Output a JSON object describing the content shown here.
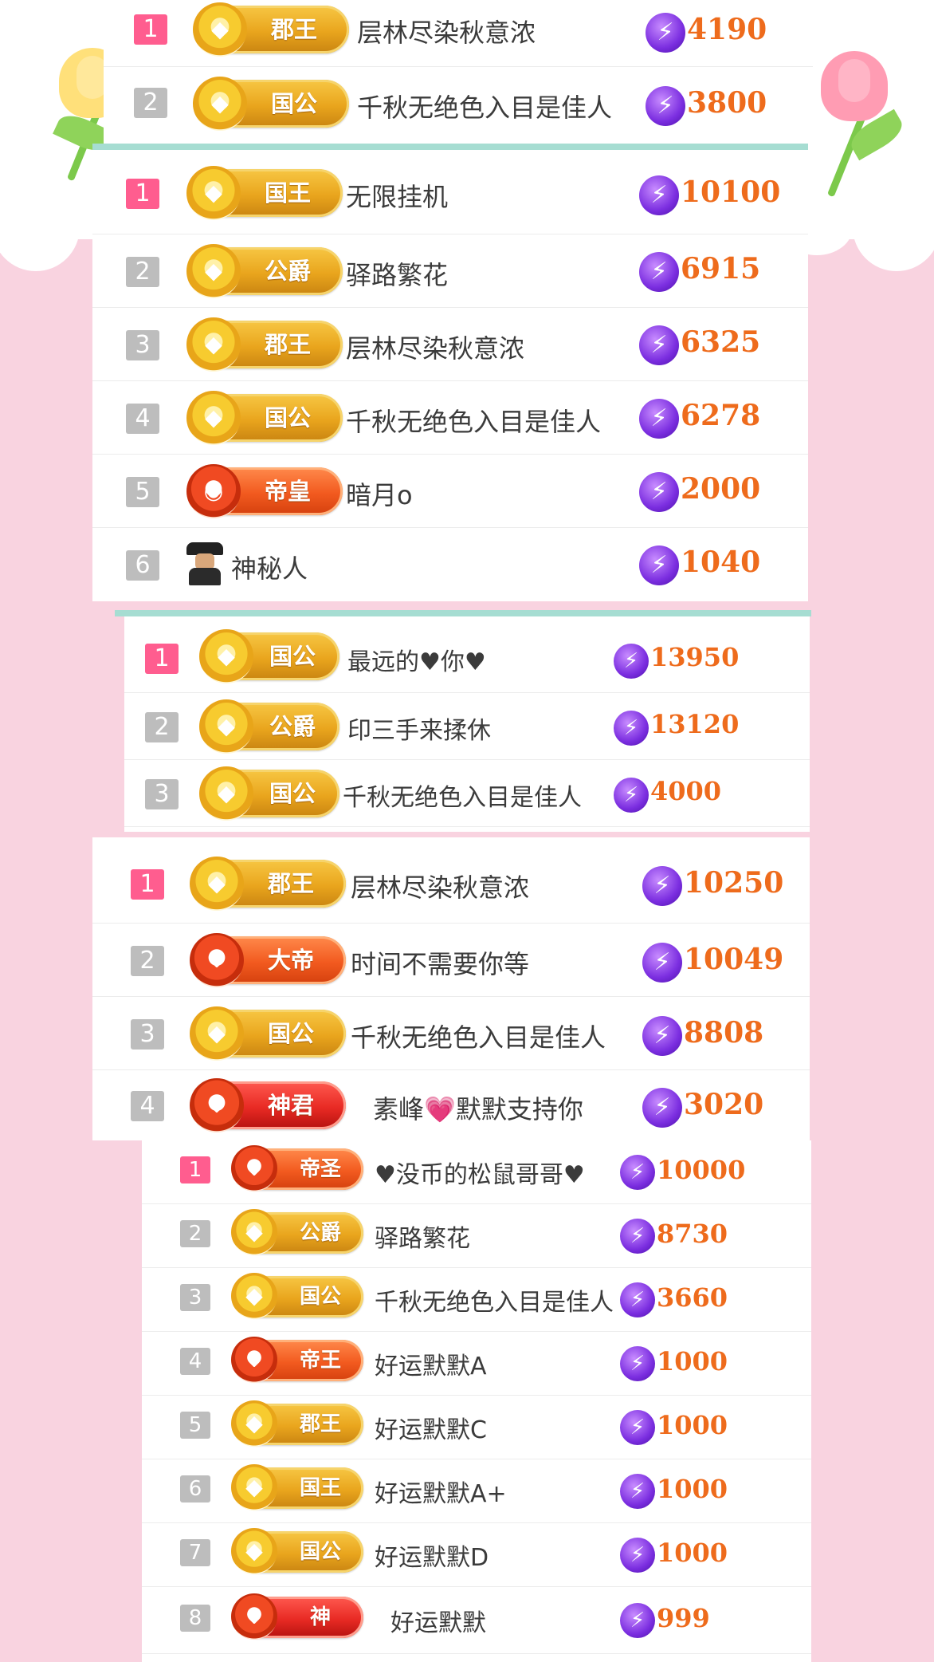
{
  "colors": {
    "page_bg": "#f9d3e0",
    "divider": "#a6ddd2",
    "score": "#ee6b1c",
    "rank_first": "#ff5d8f",
    "rank_other": "#bdbdbd",
    "badge_gold": "#e9a51d",
    "badge_red": "#f25a1f"
  },
  "icons": {
    "coin": "coin-icon",
    "bolt": "lightning-icon",
    "spy": "mystery-person-icon",
    "tulip": "tulip-icon"
  },
  "boards": [
    {
      "rows": [
        {
          "rank": "1",
          "badge": "郡王",
          "badge_style": "gold",
          "name": "层林尽染秋意浓",
          "score": "4190"
        },
        {
          "rank": "2",
          "badge": "国公",
          "badge_style": "gold",
          "name": "千秋无绝色入目是佳人",
          "score": "3800"
        }
      ]
    },
    {
      "rows": [
        {
          "rank": "1",
          "badge": "国王",
          "badge_style": "gold",
          "name": "无限挂机",
          "score": "10100"
        },
        {
          "rank": "2",
          "badge": "公爵",
          "badge_style": "gold",
          "name": "驿路繁花",
          "score": "6915"
        },
        {
          "rank": "3",
          "badge": "郡王",
          "badge_style": "gold",
          "name": "层林尽染秋意浓",
          "score": "6325"
        },
        {
          "rank": "4",
          "badge": "国公",
          "badge_style": "gold",
          "name": "千秋无绝色入目是佳人",
          "score": "6278"
        },
        {
          "rank": "5",
          "badge": "帝皇",
          "badge_style": "red",
          "name": "暗月o",
          "score": "2000"
        },
        {
          "rank": "6",
          "badge": "",
          "badge_style": "none",
          "name": "神秘人",
          "score": "1040"
        }
      ]
    },
    {
      "rows": [
        {
          "rank": "1",
          "badge": "国公",
          "badge_style": "gold",
          "name": "最远的♥你♥",
          "score": "13950"
        },
        {
          "rank": "2",
          "badge": "公爵",
          "badge_style": "gold",
          "name": "印三手来揉休",
          "score": "13120"
        },
        {
          "rank": "3",
          "badge": "国公",
          "badge_style": "gold",
          "name": "千秋无绝色入目是佳人",
          "score": "4000"
        }
      ]
    },
    {
      "rows": [
        {
          "rank": "1",
          "badge": "郡王",
          "badge_style": "gold",
          "name": "层林尽染秋意浓",
          "score": "10250"
        },
        {
          "rank": "2",
          "badge": "大帝",
          "badge_style": "red",
          "name": "时间不需要你等",
          "score": "10049"
        },
        {
          "rank": "3",
          "badge": "国公",
          "badge_style": "gold",
          "name": "千秋无绝色入目是佳人",
          "score": "8808"
        },
        {
          "rank": "4",
          "badge": "神君",
          "badge_style": "crimson",
          "name": "素峰💗默默支持你",
          "score": "3020"
        }
      ]
    },
    {
      "rows": [
        {
          "rank": "1",
          "badge": "帝圣",
          "badge_style": "red",
          "name": "♥没币的松鼠哥哥♥",
          "score": "10000"
        },
        {
          "rank": "2",
          "badge": "公爵",
          "badge_style": "gold",
          "name": "驿路繁花",
          "score": "8730"
        },
        {
          "rank": "3",
          "badge": "国公",
          "badge_style": "gold",
          "name": "千秋无绝色入目是佳人",
          "score": "3660"
        },
        {
          "rank": "4",
          "badge": "帝王",
          "badge_style": "red",
          "name": "好运默默A",
          "score": "1000"
        },
        {
          "rank": "5",
          "badge": "郡王",
          "badge_style": "gold",
          "name": "好运默默C",
          "score": "1000"
        },
        {
          "rank": "6",
          "badge": "国王",
          "badge_style": "gold",
          "name": "好运默默A+",
          "score": "1000"
        },
        {
          "rank": "7",
          "badge": "国公",
          "badge_style": "gold",
          "name": "好运默默D",
          "score": "1000"
        },
        {
          "rank": "8",
          "badge": "神",
          "badge_style": "crimson",
          "name": "好运默默",
          "score": "999"
        }
      ]
    }
  ]
}
